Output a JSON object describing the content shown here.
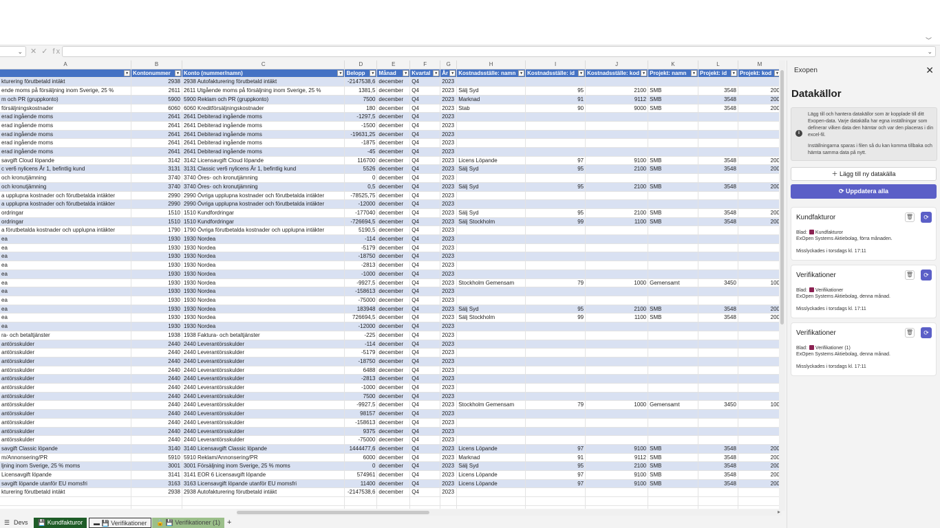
{
  "formula_bar": {
    "name_box": "",
    "icons": "✕ ✓ fx",
    "value": ""
  },
  "columns": {
    "letters": [
      "A",
      "B",
      "C",
      "D",
      "E",
      "F",
      "G",
      "H",
      "I",
      "J",
      "K",
      "L",
      "M"
    ],
    "headers": [
      "",
      "Kontonummer",
      "Konto (nummer/namn)",
      "Belopp",
      "Månad",
      "Kvartal",
      "År",
      "Kostnadsställe: namn",
      "Kostnadsställe: id",
      "Kostnadsställe: kod",
      "Projekt: namn",
      "Projekt: id",
      "Projekt: kod"
    ]
  },
  "rows": [
    [
      "kturering förutbetald intäkt",
      "2938",
      "2938 Autofakturering förutbetald intäkt",
      "-2147538,6",
      "december",
      "Q4",
      "2023",
      "",
      "",
      "",
      "",
      "",
      ""
    ],
    [
      "ende moms på försäljning inom Sverige, 25 %",
      "2611",
      "2611 Utgående moms på försäljning inom Sverige, 25 %",
      "1381,5",
      "december",
      "Q4",
      "2023",
      "Sälj Syd",
      "95",
      "2100",
      "SMB",
      "3548",
      "200"
    ],
    [
      "m och PR (gruppkonto)",
      "5900",
      "5900 Reklam och PR (gruppkonto)",
      "7500",
      "december",
      "Q4",
      "2023",
      "Marknad",
      "91",
      "9112",
      "SMB",
      "3548",
      "200"
    ],
    [
      "försäljningskostnader",
      "6060",
      "6060 Kreditförsäljningskostnader",
      "180",
      "december",
      "Q4",
      "2023",
      "Stab",
      "90",
      "9000",
      "SMB",
      "3548",
      "200"
    ],
    [
      "erad ingående moms",
      "2641",
      "2641 Debiterad ingående moms",
      "-1297,5",
      "december",
      "Q4",
      "2023",
      "",
      "",
      "",
      "",
      "",
      ""
    ],
    [
      "erad ingående moms",
      "2641",
      "2641 Debiterad ingående moms",
      "-1500",
      "december",
      "Q4",
      "2023",
      "",
      "",
      "",
      "",
      "",
      ""
    ],
    [
      "erad ingående moms",
      "2641",
      "2641 Debiterad ingående moms",
      "-19631,25",
      "december",
      "Q4",
      "2023",
      "",
      "",
      "",
      "",
      "",
      ""
    ],
    [
      "erad ingående moms",
      "2641",
      "2641 Debiterad ingående moms",
      "-1875",
      "december",
      "Q4",
      "2023",
      "",
      "",
      "",
      "",
      "",
      ""
    ],
    [
      "erad ingående moms",
      "2641",
      "2641 Debiterad ingående moms",
      "-45",
      "december",
      "Q4",
      "2023",
      "",
      "",
      "",
      "",
      "",
      ""
    ],
    [
      "savgift Cloud löpande",
      "3142",
      "3142 Licensavgift Cloud löpande",
      "116700",
      "december",
      "Q4",
      "2023",
      "Licens Löpande",
      "97",
      "9100",
      "SMB",
      "3548",
      "200"
    ],
    [
      "c ver6 nylicens År 1, befintlig kund",
      "3131",
      "3131 Classic ver6 nylicens År 1, befintlig kund",
      "5526",
      "december",
      "Q4",
      "2023",
      "Sälj Syd",
      "95",
      "2100",
      "SMB",
      "3548",
      "200"
    ],
    [
      "och kronutjämning",
      "3740",
      "3740 Öres- och kronutjämning",
      "0",
      "december",
      "Q4",
      "2023",
      "",
      "",
      "",
      "",
      "",
      ""
    ],
    [
      "och kronutjämning",
      "3740",
      "3740 Öres- och kronutjämning",
      "0,5",
      "december",
      "Q4",
      "2023",
      "Sälj Syd",
      "95",
      "2100",
      "SMB",
      "3548",
      "200"
    ],
    [
      "a upplupna kostnader och förutbetalda intäkter",
      "2990",
      "2990 Övriga upplupna kostnader och förutbetalda intäkter",
      "-78525,75",
      "december",
      "Q4",
      "2023",
      "",
      "",
      "",
      "",
      "",
      ""
    ],
    [
      "a upplupna kostnader och förutbetalda intäkter",
      "2990",
      "2990 Övriga upplupna kostnader och förutbetalda intäkter",
      "-12000",
      "december",
      "Q4",
      "2023",
      "",
      "",
      "",
      "",
      "",
      ""
    ],
    [
      "ordringar",
      "1510",
      "1510 Kundfordringar",
      "-177040",
      "december",
      "Q4",
      "2023",
      "Sälj Syd",
      "95",
      "2100",
      "SMB",
      "3548",
      "200"
    ],
    [
      "ordringar",
      "1510",
      "1510 Kundfordringar",
      "-726694,5",
      "december",
      "Q4",
      "2023",
      "Sälj Stockholm",
      "99",
      "1100",
      "SMB",
      "3548",
      "200"
    ],
    [
      "a förutbetalda kostnader och upplupna intäkter",
      "1790",
      "1790 Övriga förutbetalda kostnader och upplupna intäkter",
      "5190,5",
      "december",
      "Q4",
      "2023",
      "",
      "",
      "",
      "",
      "",
      ""
    ],
    [
      "ea",
      "1930",
      "1930 Nordea",
      "-114",
      "december",
      "Q4",
      "2023",
      "",
      "",
      "",
      "",
      "",
      ""
    ],
    [
      "ea",
      "1930",
      "1930 Nordea",
      "-5179",
      "december",
      "Q4",
      "2023",
      "",
      "",
      "",
      "",
      "",
      ""
    ],
    [
      "ea",
      "1930",
      "1930 Nordea",
      "-18750",
      "december",
      "Q4",
      "2023",
      "",
      "",
      "",
      "",
      "",
      ""
    ],
    [
      "ea",
      "1930",
      "1930 Nordea",
      "-2813",
      "december",
      "Q4",
      "2023",
      "",
      "",
      "",
      "",
      "",
      ""
    ],
    [
      "ea",
      "1930",
      "1930 Nordea",
      "-1000",
      "december",
      "Q4",
      "2023",
      "",
      "",
      "",
      "",
      "",
      ""
    ],
    [
      "ea",
      "1930",
      "1930 Nordea",
      "-9927,5",
      "december",
      "Q4",
      "2023",
      "Stockholm Gemensam",
      "79",
      "1000",
      "Gemensamt",
      "3450",
      "100"
    ],
    [
      "ea",
      "1930",
      "1930 Nordea",
      "-158613",
      "december",
      "Q4",
      "2023",
      "",
      "",
      "",
      "",
      "",
      ""
    ],
    [
      "ea",
      "1930",
      "1930 Nordea",
      "-75000",
      "december",
      "Q4",
      "2023",
      "",
      "",
      "",
      "",
      "",
      ""
    ],
    [
      "ea",
      "1930",
      "1930 Nordea",
      "183948",
      "december",
      "Q4",
      "2023",
      "Sälj Syd",
      "95",
      "2100",
      "SMB",
      "3548",
      "200"
    ],
    [
      "ea",
      "1930",
      "1930 Nordea",
      "726694,5",
      "december",
      "Q4",
      "2023",
      "Sälj Stockholm",
      "99",
      "1100",
      "SMB",
      "3548",
      "200"
    ],
    [
      "ea",
      "1930",
      "1930 Nordea",
      "-12000",
      "december",
      "Q4",
      "2023",
      "",
      "",
      "",
      "",
      "",
      ""
    ],
    [
      "ra- och betaltjänster",
      "1938",
      "1938 Faktura- och betaltjänster",
      "-225",
      "december",
      "Q4",
      "2023",
      "",
      "",
      "",
      "",
      "",
      ""
    ],
    [
      "antörsskulder",
      "2440",
      "2440 Leverantörsskulder",
      "-114",
      "december",
      "Q4",
      "2023",
      "",
      "",
      "",
      "",
      "",
      ""
    ],
    [
      "antörsskulder",
      "2440",
      "2440 Leverantörsskulder",
      "-5179",
      "december",
      "Q4",
      "2023",
      "",
      "",
      "",
      "",
      "",
      ""
    ],
    [
      "antörsskulder",
      "2440",
      "2440 Leverantörsskulder",
      "-18750",
      "december",
      "Q4",
      "2023",
      "",
      "",
      "",
      "",
      "",
      ""
    ],
    [
      "antörsskulder",
      "2440",
      "2440 Leverantörsskulder",
      "6488",
      "december",
      "Q4",
      "2023",
      "",
      "",
      "",
      "",
      "",
      ""
    ],
    [
      "antörsskulder",
      "2440",
      "2440 Leverantörsskulder",
      "-2813",
      "december",
      "Q4",
      "2023",
      "",
      "",
      "",
      "",
      "",
      ""
    ],
    [
      "antörsskulder",
      "2440",
      "2440 Leverantörsskulder",
      "-1000",
      "december",
      "Q4",
      "2023",
      "",
      "",
      "",
      "",
      "",
      ""
    ],
    [
      "antörsskulder",
      "2440",
      "2440 Leverantörsskulder",
      "7500",
      "december",
      "Q4",
      "2023",
      "",
      "",
      "",
      "",
      "",
      ""
    ],
    [
      "antörsskulder",
      "2440",
      "2440 Leverantörsskulder",
      "-9927,5",
      "december",
      "Q4",
      "2023",
      "Stockholm Gemensam",
      "79",
      "1000",
      "Gemensamt",
      "3450",
      "100"
    ],
    [
      "antörsskulder",
      "2440",
      "2440 Leverantörsskulder",
      "98157",
      "december",
      "Q4",
      "2023",
      "",
      "",
      "",
      "",
      "",
      ""
    ],
    [
      "antörsskulder",
      "2440",
      "2440 Leverantörsskulder",
      "-158613",
      "december",
      "Q4",
      "2023",
      "",
      "",
      "",
      "",
      "",
      ""
    ],
    [
      "antörsskulder",
      "2440",
      "2440 Leverantörsskulder",
      "9375",
      "december",
      "Q4",
      "2023",
      "",
      "",
      "",
      "",
      "",
      ""
    ],
    [
      "antörsskulder",
      "2440",
      "2440 Leverantörsskulder",
      "-75000",
      "december",
      "Q4",
      "2023",
      "",
      "",
      "",
      "",
      "",
      ""
    ],
    [
      "savgift Classic löpande",
      "3140",
      "3140 Licensavgift Classic löpande",
      "1444477,6",
      "december",
      "Q4",
      "2023",
      "Licens Löpande",
      "97",
      "9100",
      "SMB",
      "3548",
      "200"
    ],
    [
      "m/Annonsering/PR",
      "5910",
      "5910 Reklam/Annonsering/PR",
      "6000",
      "december",
      "Q4",
      "2023",
      "Marknad",
      "91",
      "9112",
      "SMB",
      "3548",
      "200"
    ],
    [
      "ljning inom Sverige, 25 % moms",
      "3001",
      "3001 Försäljning inom Sverige, 25 % moms",
      "0",
      "december",
      "Q4",
      "2023",
      "Sälj Syd",
      "95",
      "2100",
      "SMB",
      "3548",
      "200"
    ],
    [
      "Licensavgift löpande",
      "3141",
      "3141 EOR 6 Licensavgift löpande",
      "574961",
      "december",
      "Q4",
      "2023",
      "Licens Löpande",
      "97",
      "9100",
      "SMB",
      "3548",
      "200"
    ],
    [
      "savgift löpande utanför EU momsfri",
      "3163",
      "3163 Licensavgift löpande utanför EU momsfri",
      "11400",
      "december",
      "Q4",
      "2023",
      "Licens Löpande",
      "97",
      "9100",
      "SMB",
      "3548",
      "200"
    ],
    [
      "kturering förutbetald intäkt",
      "2938",
      "2938 Autofakturering förutbetald intäkt",
      "-2147538,6",
      "december",
      "Q4",
      "2023",
      "",
      "",
      "",
      "",
      "",
      ""
    ]
  ],
  "sheet_tabs": {
    "menu_icon": "☰",
    "items": [
      {
        "label": "Devs"
      },
      {
        "label": "Kundfakturor"
      },
      {
        "label": "Verifikationer"
      },
      {
        "label": "Verifikationer (1)"
      }
    ],
    "add": "+"
  },
  "panel": {
    "app_name": "Exopen",
    "close_icon": "✕",
    "heading": "Datakällor",
    "info_icon": "i",
    "info_text_1": "Lägg till och hantera datakällor som är kopplade till ditt Exopen-data. Varje datakälla har egna inställningar som definerar vilken data den hämtar och var den placeras i din excel-fil.",
    "info_text_2": "Inställningarna sparas i filen så du kan komma tillbaka och hämta samma data på nytt.",
    "add_button": "Lägg till ny datakälla",
    "update_button": "Uppdatera alla",
    "cards": [
      {
        "title": "Kundfakturor",
        "sheet": "Blad:",
        "sheet_name": "Kundfakturor",
        "desc": "ExOpen Systems Aktiebolag, förra månaden.",
        "status": "Misslyckades i torsdags kl. 17:11"
      },
      {
        "title": "Verifikationer",
        "sheet": "Blad:",
        "sheet_name": "Verifikationer",
        "desc": "ExOpen Systems Aktiebolag, denna månad.",
        "status": "Misslyckades i torsdags kl. 17:11"
      },
      {
        "title": "Verifikationer",
        "sheet": "Blad:",
        "sheet_name": "Verifikationer (1)",
        "desc": "ExOpen Systems Aktiebolag, denna månad.",
        "status": "Misslyckades i torsdags kl. 17:11"
      }
    ]
  },
  "colors": {
    "header_blue": "#4472c4",
    "band_blue": "#d9e1f2",
    "accent": "#5b5fc7",
    "active_tab": "#1e5c27"
  }
}
